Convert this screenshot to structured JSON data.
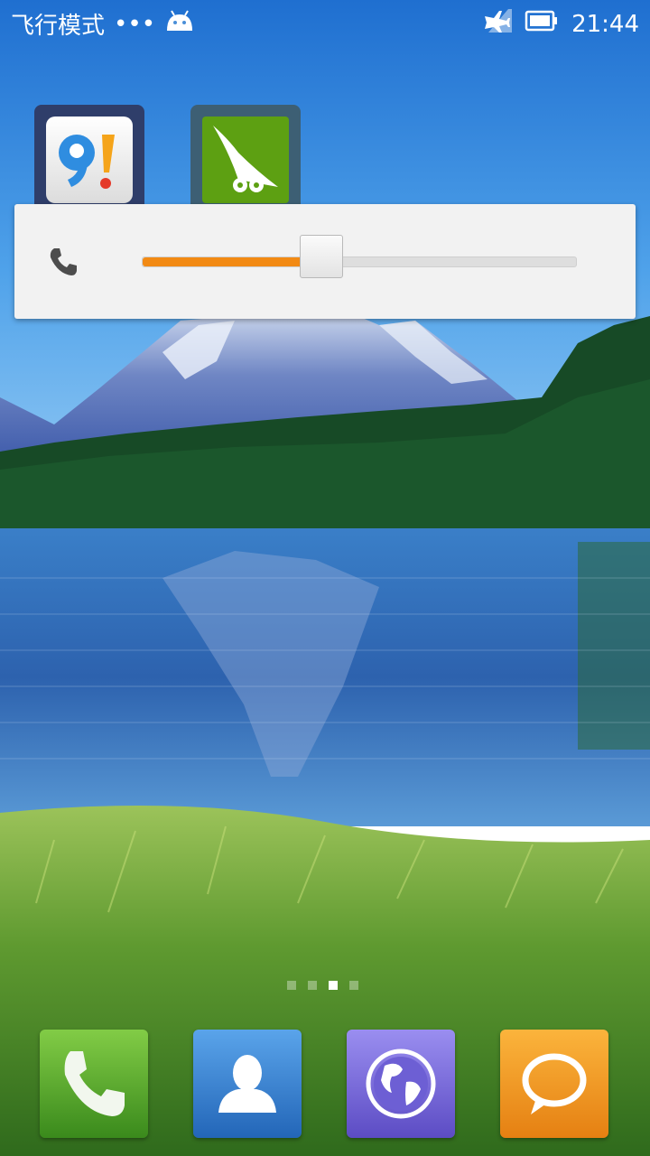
{
  "status_bar": {
    "mode_text": "飞行模式",
    "dots_text": "•••",
    "time": "21:44",
    "icons": [
      "android-icon",
      "airplane-icon",
      "battery-icon"
    ]
  },
  "home_apps": [
    {
      "name": "91-assistant-app-icon"
    },
    {
      "name": "wandoujia-app-icon"
    }
  ],
  "volume_panel": {
    "icon": "phone-icon",
    "level_fraction": 0.41
  },
  "page_indicator": {
    "pages": 4,
    "active_index": 2
  },
  "dock": {
    "apps": [
      "phone-app-icon",
      "contacts-app-icon",
      "browser-app-icon",
      "messaging-app-icon"
    ]
  },
  "colors": {
    "accent": "#f28a14",
    "sky": "#3a90e0",
    "lake": "#2f6fc0",
    "forest": "#184d2a",
    "grass": "#4c8a2a"
  }
}
